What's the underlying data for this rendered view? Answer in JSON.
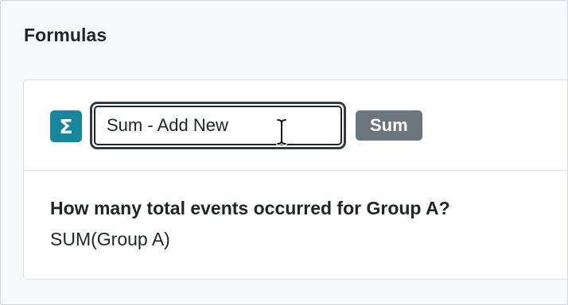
{
  "section": {
    "title": "Formulas"
  },
  "formula_card": {
    "icon": "sigma-icon",
    "icon_glyph": "Σ",
    "icon_color": "#17869b",
    "name_input": {
      "value": "Sum - Add New"
    },
    "type_badge": {
      "label": "Sum",
      "color": "#6c757d"
    },
    "question": "How many total events occurred for Group A?",
    "expression": "SUM(Group A)"
  }
}
